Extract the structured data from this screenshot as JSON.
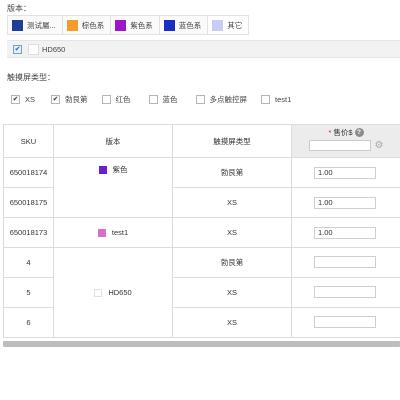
{
  "version_section": {
    "label": "版本：",
    "colors": [
      {
        "label": "测试屬...",
        "color": "#1f3f97"
      },
      {
        "label": "棕色系",
        "color": "#f39b2b"
      },
      {
        "label": "紫色系",
        "color": "#9a16c8"
      },
      {
        "label": "蓝色系",
        "color": "#1a2ec4"
      },
      {
        "label": "其它",
        "color": "#c8cef2"
      }
    ],
    "selected": {
      "label": "HD650",
      "checked": "✔"
    }
  },
  "touch_section": {
    "label": "触摸屏类型：",
    "options": [
      {
        "label": "XS",
        "checked": "✔"
      },
      {
        "label": "勃艮第",
        "checked": "✔"
      },
      {
        "label": "红色",
        "checked": ""
      },
      {
        "label": "蓝色",
        "checked": ""
      },
      {
        "label": "多点触控屏",
        "checked": ""
      },
      {
        "label": "test1",
        "checked": ""
      }
    ]
  },
  "table": {
    "headers": {
      "sku": "SKU",
      "version": "版本",
      "touch": "触摸屏类型",
      "price_req": "*",
      "price": "售价$",
      "help": "?",
      "gear": "⚙"
    },
    "groups": [
      {
        "version": "紫色",
        "color": "#6a1fd1"
      },
      {
        "version": "test1",
        "color": "#d36fd0"
      },
      {
        "version": "HD650",
        "color": "#ffffff"
      }
    ],
    "rows": [
      {
        "sku": "650018174",
        "touch": "勃艮第",
        "price": "1.00"
      },
      {
        "sku": "650018175",
        "touch": "XS",
        "price": "1.00"
      },
      {
        "sku": "650018173",
        "touch": "XS",
        "price": "1.00"
      },
      {
        "sku": "4",
        "touch": "勃艮第",
        "price": ""
      },
      {
        "sku": "5",
        "touch": "XS",
        "price": ""
      },
      {
        "sku": "6",
        "touch": "XS",
        "price": ""
      }
    ]
  }
}
